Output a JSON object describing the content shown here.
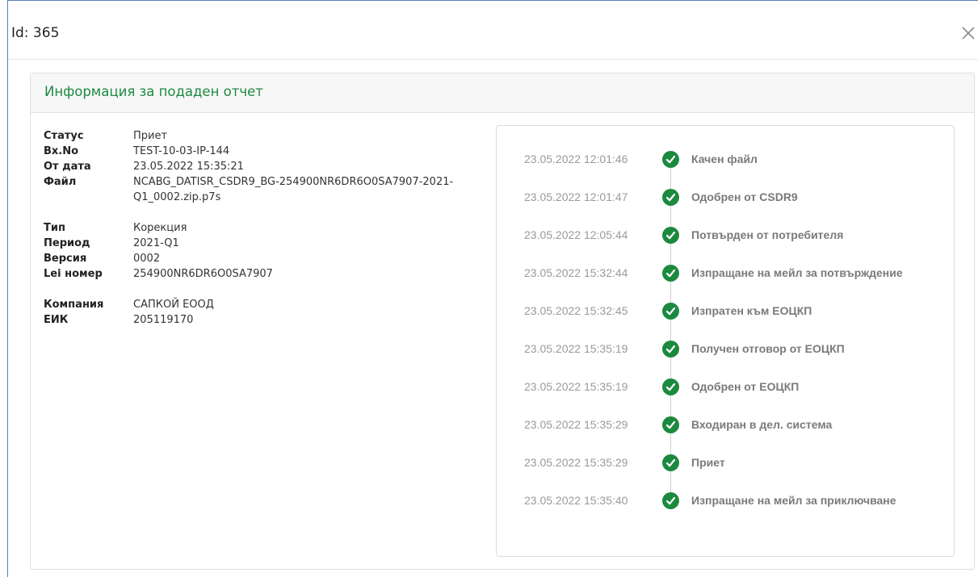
{
  "modal": {
    "title": "Id: 365",
    "close_icon": "close-icon"
  },
  "card": {
    "title": "Информация за подаден отчет"
  },
  "details": {
    "group1": [
      {
        "label": "Статус",
        "value": "Приет"
      },
      {
        "label": "Вх.No",
        "value": "TEST-10-03-IP-144"
      },
      {
        "label": "От дата",
        "value": "23.05.2022 15:35:21"
      },
      {
        "label": "Файл",
        "value": "NCABG_DATISR_CSDR9_BG-254900NR6DR6O0SA7907-2021-Q1_0002.zip.p7s"
      }
    ],
    "group2": [
      {
        "label": "Тип",
        "value": "Корекция"
      },
      {
        "label": "Период",
        "value": "2021-Q1"
      },
      {
        "label": "Версия",
        "value": "0002"
      },
      {
        "label": "Lei номер",
        "value": "254900NR6DR6O0SA7907"
      }
    ],
    "group3": [
      {
        "label": "Компания",
        "value": "САПКОЙ ЕООД"
      },
      {
        "label": "ЕИК",
        "value": "205119170"
      }
    ]
  },
  "timeline": {
    "icon": "check-circle-icon",
    "accent_color": "#1b8a3f",
    "items": [
      {
        "date": "23.05.2022 12:01:46",
        "label": "Качен файл"
      },
      {
        "date": "23.05.2022 12:01:47",
        "label": "Одобрен от CSDR9"
      },
      {
        "date": "23.05.2022 12:05:44",
        "label": "Потвърден от потребителя"
      },
      {
        "date": "23.05.2022 15:32:44",
        "label": "Изпращане на мейл за потвърждение"
      },
      {
        "date": "23.05.2022 15:32:45",
        "label": "Изпратен към ЕОЦКП"
      },
      {
        "date": "23.05.2022 15:35:19",
        "label": "Получен отговор от ЕОЦКП"
      },
      {
        "date": "23.05.2022 15:35:19",
        "label": "Одобрен от ЕОЦКП"
      },
      {
        "date": "23.05.2022 15:35:29",
        "label": "Входиран в дел. система"
      },
      {
        "date": "23.05.2022 15:35:29",
        "label": "Приет"
      },
      {
        "date": "23.05.2022 15:35:40",
        "label": "Изпращане на мейл за приключване"
      }
    ]
  }
}
